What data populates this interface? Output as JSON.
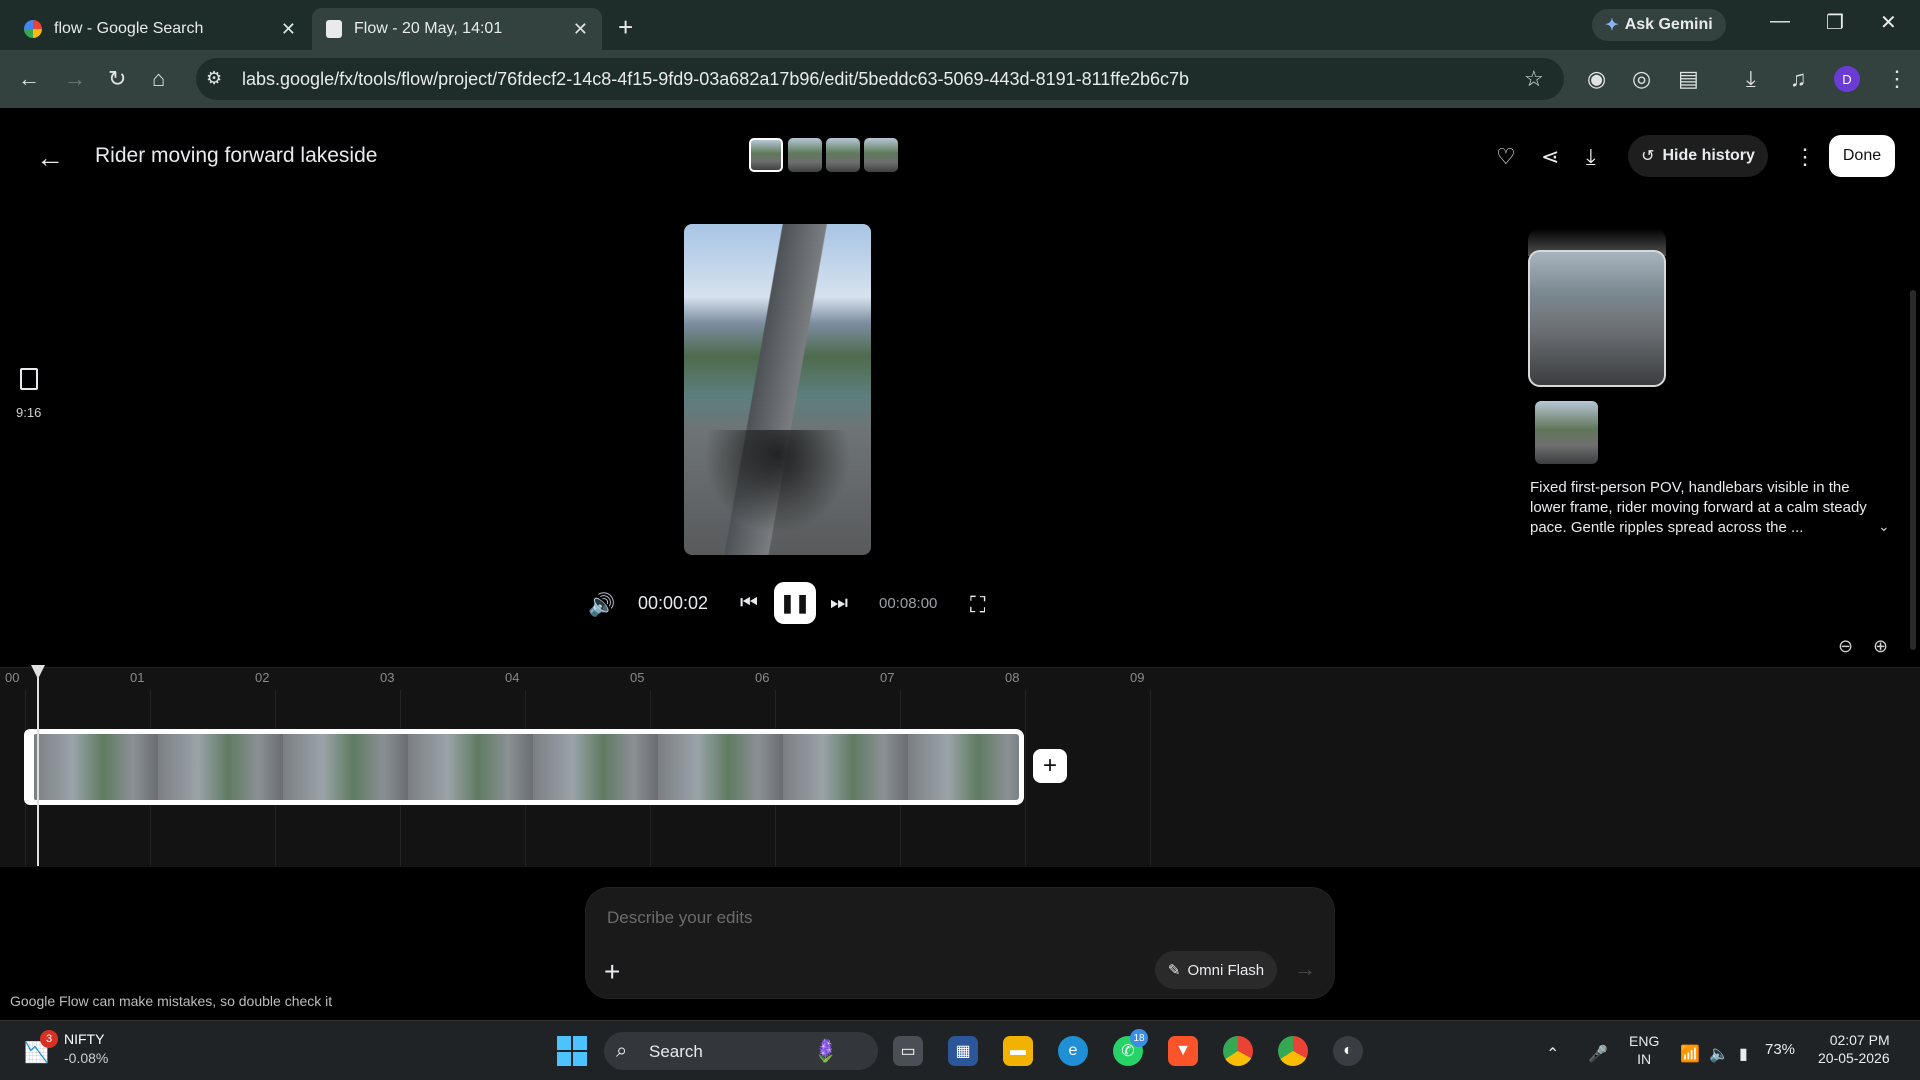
{
  "browser": {
    "tabs": [
      {
        "title": "flow - Google Search",
        "icon": "google-icon"
      },
      {
        "title": "Flow - 20 May, 14:01",
        "icon": "page-icon"
      }
    ],
    "ask_gemini": "Ask Gemini",
    "url": "labs.google/fx/tools/flow/project/76fdecf2-14c8-4f15-9fd9-03a682a17b96/edit/5beddc63-5069-443d-8191-811ffe2b6c7b",
    "profile_initial": "D"
  },
  "app": {
    "title": "Rider moving forward lakeside",
    "hide_history_label": "Hide history",
    "done_label": "Done",
    "aspect_ratio": "9:16",
    "player": {
      "current_time": "00:00:02",
      "total_time": "00:08:00",
      "state": "playing"
    },
    "history": {
      "description": "Fixed first-person POV, handlebars visible in the lower frame, rider moving forward at a calm steady pace. Gentle ripples spread across the ..."
    },
    "timeline": {
      "ticks": [
        "00",
        "01",
        "02",
        "03",
        "04",
        "05",
        "06",
        "07",
        "08",
        "09"
      ]
    },
    "prompt": {
      "placeholder": "Describe your edits",
      "model": "Omni Flash"
    },
    "disclaimer": "Google Flow can make mistakes, so double check it"
  },
  "taskbar": {
    "nifty_badge": "3",
    "nifty_label": "NIFTY",
    "nifty_change": "-0.08%",
    "search_label": "Search",
    "whatsapp_badge": "18",
    "lang_line1": "ENG",
    "lang_line2": "IN",
    "battery": "73%",
    "time": "02:07 PM",
    "date": "20-05-2026"
  },
  "colors": {
    "accent_blue": "#4cc2ff",
    "browser_frame": "#1f2d2a",
    "done_button": "#ffffff"
  }
}
